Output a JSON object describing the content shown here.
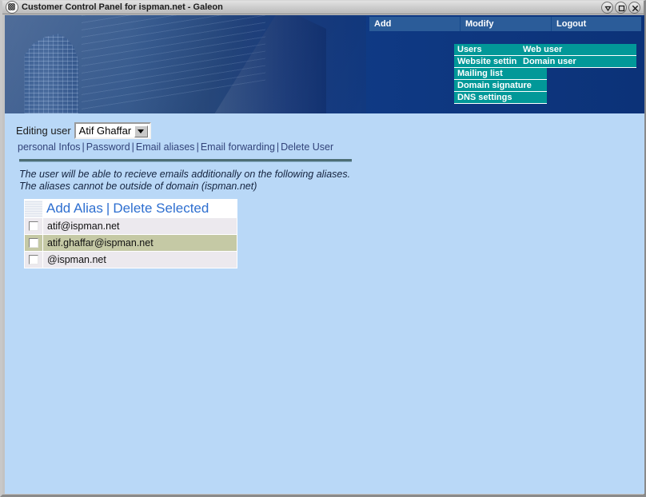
{
  "window": {
    "title": "Customer Control Panel for ispman.net - Galeon",
    "app_icon": "galeon-icon",
    "buttons": {
      "minimize": "minimize-icon",
      "maximize": "maximize-icon",
      "close": "close-icon"
    }
  },
  "nav": {
    "top": [
      {
        "label": "Add"
      },
      {
        "label": "Modify"
      },
      {
        "label": "Logout"
      }
    ],
    "dropdown": [
      {
        "label": "Users"
      },
      {
        "label": "Website settin"
      },
      {
        "label": "Mailing list"
      },
      {
        "label": "Domain signature"
      },
      {
        "label": "DNS settings"
      }
    ],
    "submenu": [
      {
        "label": "Web user"
      },
      {
        "label": "Domain user"
      }
    ]
  },
  "page": {
    "editing_label": "Editing user",
    "selected_user": "Atif Ghaffar",
    "user_options": [
      "Atif Ghaffar"
    ],
    "links": [
      {
        "label": "personal Infos"
      },
      {
        "label": "Password"
      },
      {
        "label": "Email aliases"
      },
      {
        "label": "Email forwarding"
      },
      {
        "label": "Delete User"
      }
    ],
    "link_separator": "|",
    "description_line1": "The user will be able to recieve emails additionally on the following aliases.",
    "description_line2": "The aliases cannot be outside of domain (ispman.net)",
    "actions": {
      "add_alias": "Add Alias",
      "separator": "|",
      "delete_selected": "Delete Selected"
    },
    "aliases": [
      {
        "address": "atif@ispman.net",
        "checked": false,
        "highlighted": false
      },
      {
        "address": "atif.ghaffar@ispman.net",
        "checked": false,
        "highlighted": true
      },
      {
        "address": "@ispman.net",
        "checked": false,
        "highlighted": false
      }
    ]
  },
  "colors": {
    "page_background": "#b9d8f7",
    "banner_navy": "#0e3a86",
    "nav_blue": "#2b5c99",
    "menu_teal": "#029898",
    "link_blue": "#33447a",
    "action_link": "#2e6fd0",
    "row_background": "#ece9ee",
    "row_highlight": "#c5c9a5"
  }
}
